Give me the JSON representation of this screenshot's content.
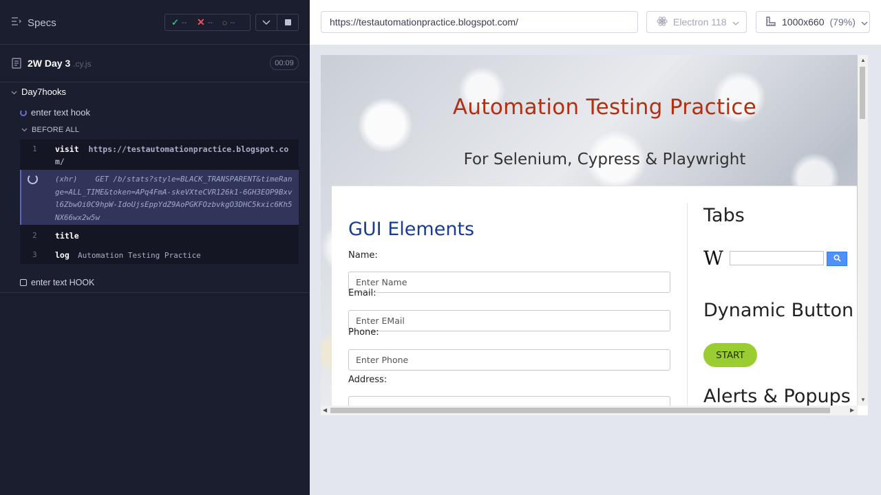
{
  "reporter": {
    "specs_label": "Specs",
    "stats": {
      "passed": "--",
      "failed": "--",
      "pending": "--"
    },
    "spec": {
      "name": "2W Day 3",
      "ext": ".cy.js",
      "duration": "00:09"
    },
    "suite": {
      "title": "Day7hooks"
    },
    "test1": {
      "title": "enter text hook"
    },
    "hook": {
      "label": "BEFORE ALL"
    },
    "commands": [
      {
        "num": "1",
        "name": "visit",
        "message": "https://testautomationpractice.blogspot.com/"
      },
      {
        "type": "(xhr)",
        "message": "GET /b/stats?style=BLACK_TRANSPARENT&timeRange=ALL_TIME&token=APq4FmA-skeVXteCVR126k1-6GH3EOP9Bxvl6ZbwOi0C9hpW-IdoUjsEppYdZ9AoPGKFOzbvkgO3DHC5kxic6Kh5NX66wx2w5w"
      },
      {
        "num": "2",
        "name": "title",
        "message": ""
      },
      {
        "num": "3",
        "name": "log",
        "message": "Automation Testing Practice"
      }
    ],
    "test2": {
      "title": "enter text HOOK"
    }
  },
  "aut": {
    "url": "https://testautomationpractice.blogspot.com/",
    "browser": "Electron 118",
    "viewport": "1000x660",
    "zoom": "(79%)",
    "page": {
      "title": "Automation Testing Practice",
      "subtitle": "For Selenium, Cypress & Playwright",
      "gui_title": "GUI Elements",
      "fields": [
        {
          "label": "Name:",
          "placeholder": "Enter Name"
        },
        {
          "label": "Email:",
          "placeholder": "Enter EMail"
        },
        {
          "label": "Phone:",
          "placeholder": "Enter Phone"
        },
        {
          "label": "Address:",
          "placeholder": ""
        }
      ],
      "tabs_title": "Tabs",
      "wiki_logo": "W",
      "dynamic_title": "Dynamic Button",
      "start_label": "START",
      "alerts_title": "Alerts & Popups"
    }
  }
}
